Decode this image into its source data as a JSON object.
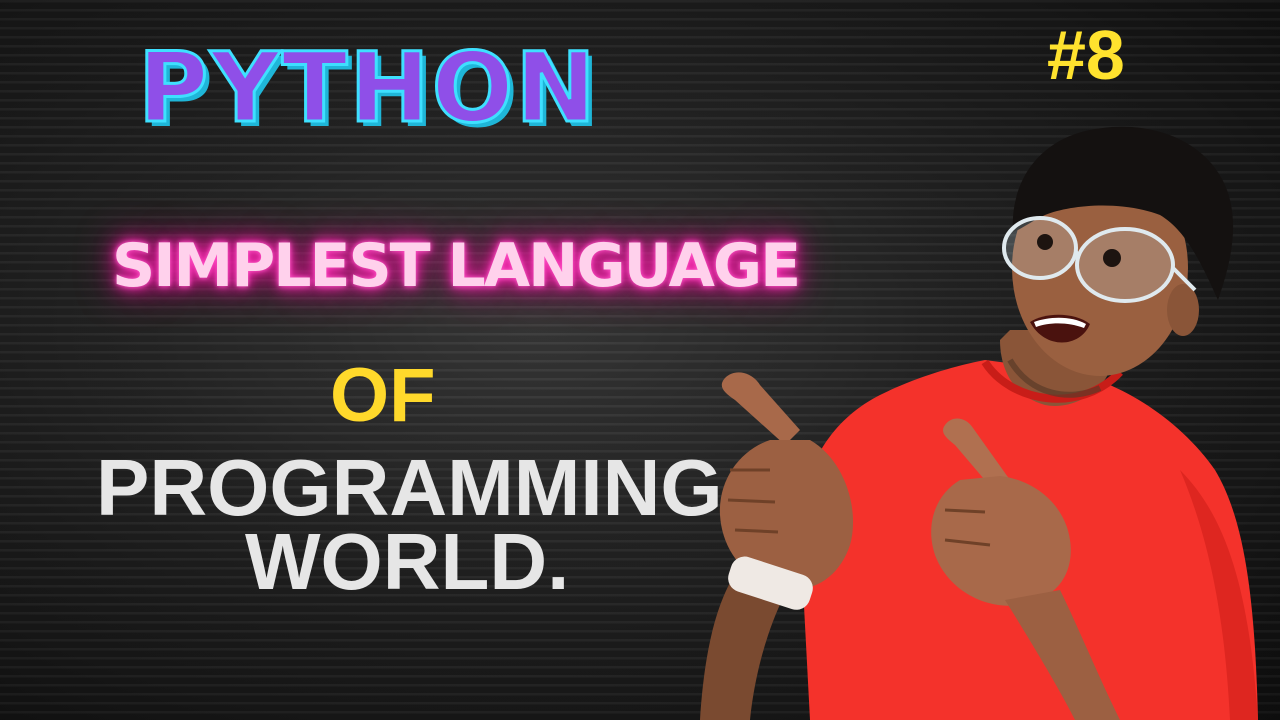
{
  "thumbnail": {
    "title": "PYTHON",
    "issue_number": "#8",
    "subtitle": "SIMPLEST LANGUAGE",
    "line_of": "OF",
    "line_programming": "PROGRAMMING",
    "line_world": "WORLD."
  },
  "colors": {
    "background": "#1b1b1b",
    "title_fill": "#8f4fe8",
    "title_outline": "#3ee0ff",
    "neon_pink": "#ff33bb",
    "yellow": "#ffd92b",
    "light_gray_text": "#e6e6e6",
    "shirt_red": "#f4322b"
  },
  "illustration": {
    "subject": "presenter-pointing",
    "icons": [
      "presenter-figure",
      "pointing-hand-icon",
      "glasses-icon",
      "watch-icon"
    ]
  }
}
